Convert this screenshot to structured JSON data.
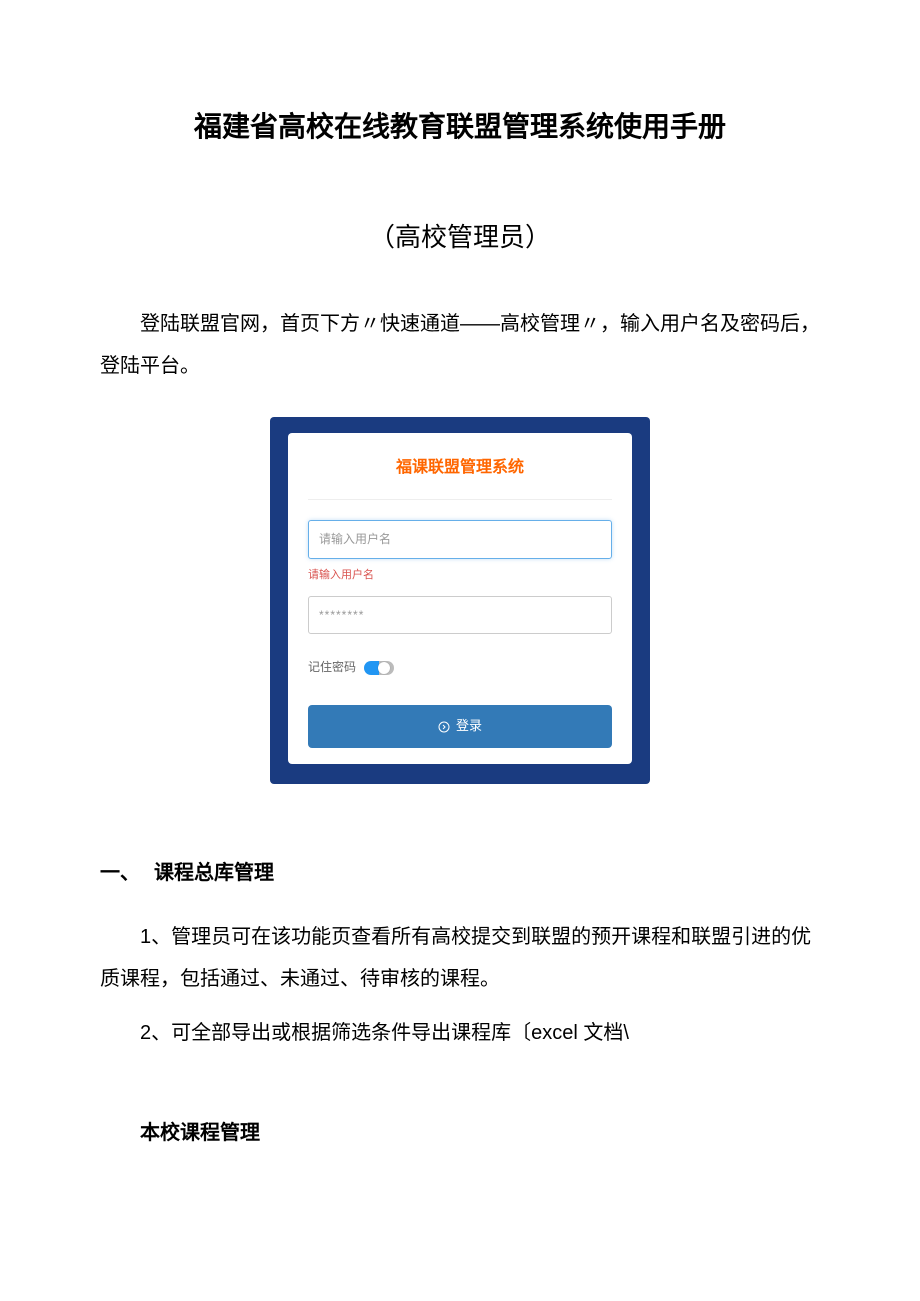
{
  "doc": {
    "title": "福建省高校在线教育联盟管理系统使用手册",
    "subtitle": "（高校管理员）",
    "intro": "登陆联盟官网，首页下方〃快速通道——高校管理〃，输入用户名及密码后，登陆平台。"
  },
  "login": {
    "title": "福课联盟管理系统",
    "username_placeholder": "请输入用户名",
    "username_error": "请输入用户名",
    "password_mask": "********",
    "remember_label": "记住密码",
    "submit_label": "登录"
  },
  "sections": {
    "s1": {
      "num": "一、",
      "title": "课程总库管理",
      "p1": "1、管理员可在该功能页查看所有高校提交到联盟的预开课程和联盟引进的优质课程，包括通过、未通过、待审核的课程。",
      "p2": "2、可全部导出或根据筛选条件导出课程库〔excel 文档\\"
    },
    "s2": {
      "title": "本校课程管理"
    }
  }
}
